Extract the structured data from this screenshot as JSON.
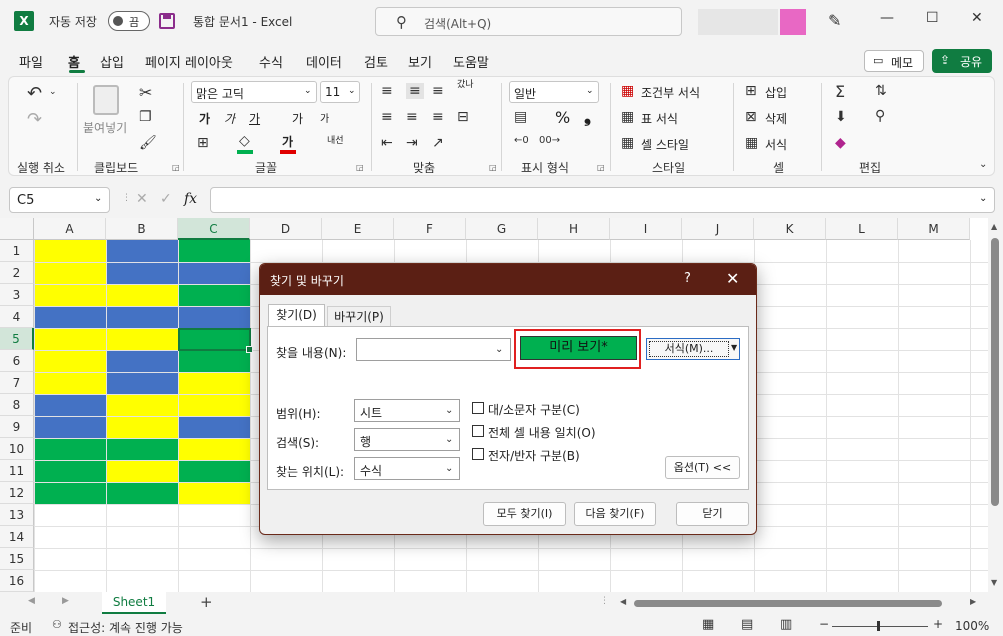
{
  "titlebar": {
    "app_icon": "X",
    "autosave_label": "자동 저장",
    "autosave_state": "끔",
    "doc_title": "통합 문서1  -  Excel",
    "search_placeholder": "검색(Alt+Q)",
    "minimize": "—",
    "maximize": "☐",
    "close": "✕"
  },
  "ribbon_tabs": [
    "파일",
    "홈",
    "삽입",
    "페이지 레이아웃",
    "수식",
    "데이터",
    "검토",
    "보기",
    "도움말"
  ],
  "memo_label": "메모",
  "share_label": "공유",
  "ribbon": {
    "undo_label": "실행 취소",
    "clipboard": {
      "paste": "붙여넣기",
      "label": "클립보드"
    },
    "font": {
      "name": "맑은 고딕",
      "size": "11",
      "label": "글꼴",
      "inc": "가",
      "dec": "가",
      "bold": "가",
      "italic": "가",
      "underline": "가",
      "strike": "가",
      "color_a": "가",
      "phonetic": "내선"
    },
    "align": {
      "label": "맞춤",
      "wrap": "갔나"
    },
    "number": {
      "format": "일반",
      "label": "표시 형식",
      "percent": "%",
      "comma": "❟"
    },
    "style": {
      "cond": "조건부 서식",
      "table": "표 서식",
      "cell": "셀 스타일",
      "label": "스타일"
    },
    "cells": {
      "insert": "삽입",
      "delete": "삭제",
      "format": "서식",
      "label": "셀"
    },
    "edit": {
      "label": "편집"
    }
  },
  "formula": {
    "namebox": "C5",
    "fx": "fx",
    "value": ""
  },
  "grid": {
    "columns": [
      "A",
      "B",
      "C",
      "D",
      "E",
      "F",
      "G",
      "H",
      "I",
      "J",
      "K",
      "L",
      "M"
    ],
    "rows": [
      "1",
      "2",
      "3",
      "4",
      "5",
      "6",
      "7",
      "8",
      "9",
      "10",
      "11",
      "12",
      "13",
      "14",
      "15",
      "16"
    ],
    "selected_col": "C",
    "selected_row": "5",
    "colors": {
      "yellow": "#ffff00",
      "blue": "#4472c4",
      "green": "#00b050"
    },
    "fills": [
      [
        "yellow",
        "blue",
        "green"
      ],
      [
        "yellow",
        "blue",
        "blue"
      ],
      [
        "yellow",
        "yellow",
        "green"
      ],
      [
        "blue",
        "blue",
        "blue"
      ],
      [
        "yellow",
        "yellow",
        "green"
      ],
      [
        "yellow",
        "blue",
        "green"
      ],
      [
        "yellow",
        "blue",
        "yellow"
      ],
      [
        "blue",
        "yellow",
        "yellow"
      ],
      [
        "blue",
        "yellow",
        "blue"
      ],
      [
        "green",
        "green",
        "yellow"
      ],
      [
        "green",
        "yellow",
        "green"
      ],
      [
        "green",
        "green",
        "yellow"
      ]
    ]
  },
  "sheet": {
    "tab": "Sheet1",
    "add": "+"
  },
  "status": {
    "ready": "준비",
    "accessibility": "접근성: 계속 진행 가능",
    "zoom": "100%"
  },
  "dialog": {
    "title": "찾기 및 바꾸기",
    "help": "?",
    "close": "✕",
    "tab_find": "찾기(D)",
    "tab_replace": "바꾸기(P)",
    "find_label": "찾을 내용(N):",
    "find_value": "",
    "preview": "미리 보기*",
    "format_btn": "서식(M)...",
    "scope_label": "범위(H):",
    "scope_value": "시트",
    "search_label": "검색(S):",
    "search_value": "행",
    "lookin_label": "찾는 위치(L):",
    "lookin_value": "수식",
    "case": "대/소문자 구분(C)",
    "whole": "전체 셀 내용 일치(O)",
    "width": "전자/반자 구분(B)",
    "options_btn": "옵션(T) <<",
    "find_all": "모두 찾기(I)",
    "find_next": "다음 찾기(F)",
    "close_btn": "닫기"
  }
}
